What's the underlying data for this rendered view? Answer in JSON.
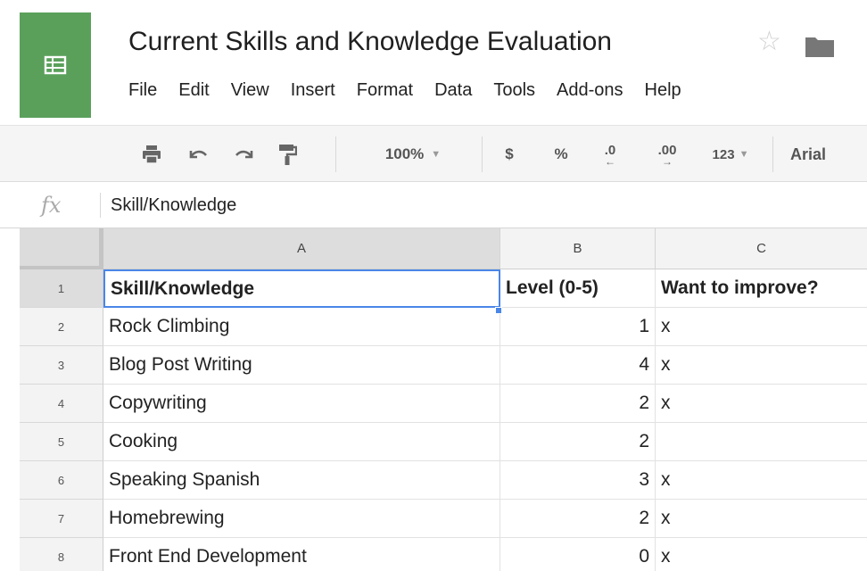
{
  "doc": {
    "title": "Current Skills and Knowledge Evaluation",
    "icons": {
      "logo": "sheets-grid-icon",
      "star": "star-icon",
      "folder": "folder-icon"
    }
  },
  "menu": [
    "File",
    "Edit",
    "View",
    "Insert",
    "Format",
    "Data",
    "Tools",
    "Add-ons",
    "Help"
  ],
  "toolbar": {
    "icons": [
      "print-icon",
      "undo-icon",
      "redo-icon",
      "paint-format-icon"
    ],
    "zoom": "100%",
    "currency": "$",
    "percent": "%",
    "decrease_decimal": ".0",
    "increase_decimal": ".00",
    "number_format": "123",
    "font": "Arial"
  },
  "formula_bar": {
    "label": "fx",
    "value": "Skill/Knowledge"
  },
  "grid": {
    "columns": [
      "A",
      "B",
      "C"
    ],
    "rows": [
      {
        "num": "1",
        "a": "Skill/Knowledge",
        "b": "Level (0-5)",
        "c": "Want to improve?"
      },
      {
        "num": "2",
        "a": "Rock Climbing",
        "b": "1",
        "c": "x"
      },
      {
        "num": "3",
        "a": "Blog Post Writing",
        "b": "4",
        "c": "x"
      },
      {
        "num": "4",
        "a": "Copywriting",
        "b": "2",
        "c": "x"
      },
      {
        "num": "5",
        "a": "Cooking",
        "b": "2",
        "c": ""
      },
      {
        "num": "6",
        "a": "Speaking Spanish",
        "b": "3",
        "c": "x"
      },
      {
        "num": "7",
        "a": "Homebrewing",
        "b": "2",
        "c": "x"
      },
      {
        "num": "8",
        "a": "Front End Development",
        "b": "0",
        "c": "x"
      }
    ],
    "selected_cell": "A1"
  },
  "colors": {
    "logo": "#5aa05b",
    "selection": "#4a86e8",
    "toolbar_bg": "#f5f5f5"
  }
}
